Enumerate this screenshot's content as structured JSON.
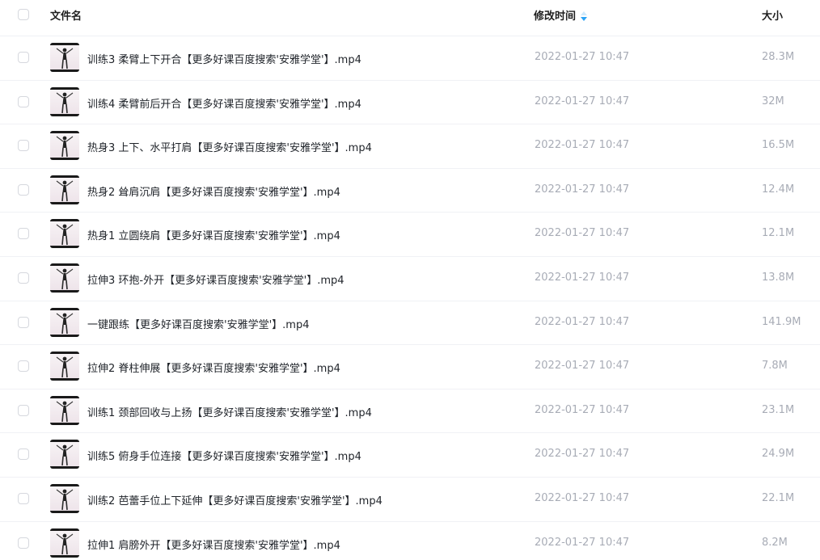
{
  "header": {
    "name_label": "文件名",
    "time_label": "修改时间",
    "size_label": "大小",
    "sort_icon": "sort-arrows-icon",
    "sort_color": "#2ba3f5"
  },
  "files": [
    {
      "name": "训练3 柔臂上下开合【更多好课百度搜索'安雅学堂'】.mp4",
      "time": "2022-01-27 10:47",
      "size": "28.3M"
    },
    {
      "name": "训练4 柔臂前后开合【更多好课百度搜索'安雅学堂'】.mp4",
      "time": "2022-01-27 10:47",
      "size": "32M"
    },
    {
      "name": "热身3 上下、水平打肩【更多好课百度搜索'安雅学堂'】.mp4",
      "time": "2022-01-27 10:47",
      "size": "16.5M"
    },
    {
      "name": "热身2 耸肩沉肩【更多好课百度搜索'安雅学堂'】.mp4",
      "time": "2022-01-27 10:47",
      "size": "12.4M"
    },
    {
      "name": "热身1 立圆绕肩【更多好课百度搜索'安雅学堂'】.mp4",
      "time": "2022-01-27 10:47",
      "size": "12.1M"
    },
    {
      "name": "拉伸3 环抱-外开【更多好课百度搜索'安雅学堂'】.mp4",
      "time": "2022-01-27 10:47",
      "size": "13.8M"
    },
    {
      "name": "一键跟练【更多好课百度搜索'安雅学堂'】.mp4",
      "time": "2022-01-27 10:47",
      "size": "141.9M"
    },
    {
      "name": "拉伸2 脊柱伸展【更多好课百度搜索'安雅学堂'】.mp4",
      "time": "2022-01-27 10:47",
      "size": "7.8M"
    },
    {
      "name": "训练1 颈部回收与上扬【更多好课百度搜索'安雅学堂'】.mp4",
      "time": "2022-01-27 10:47",
      "size": "23.1M"
    },
    {
      "name": "训练5 俯身手位连接【更多好课百度搜索'安雅学堂'】.mp4",
      "time": "2022-01-27 10:47",
      "size": "24.9M"
    },
    {
      "name": "训练2 芭蕾手位上下延伸【更多好课百度搜索'安雅学堂'】.mp4",
      "time": "2022-01-27 10:47",
      "size": "22.1M"
    },
    {
      "name": "拉伸1 肩膀外开【更多好课百度搜索'安雅学堂'】.mp4",
      "time": "2022-01-27 10:47",
      "size": "8.2M"
    }
  ]
}
